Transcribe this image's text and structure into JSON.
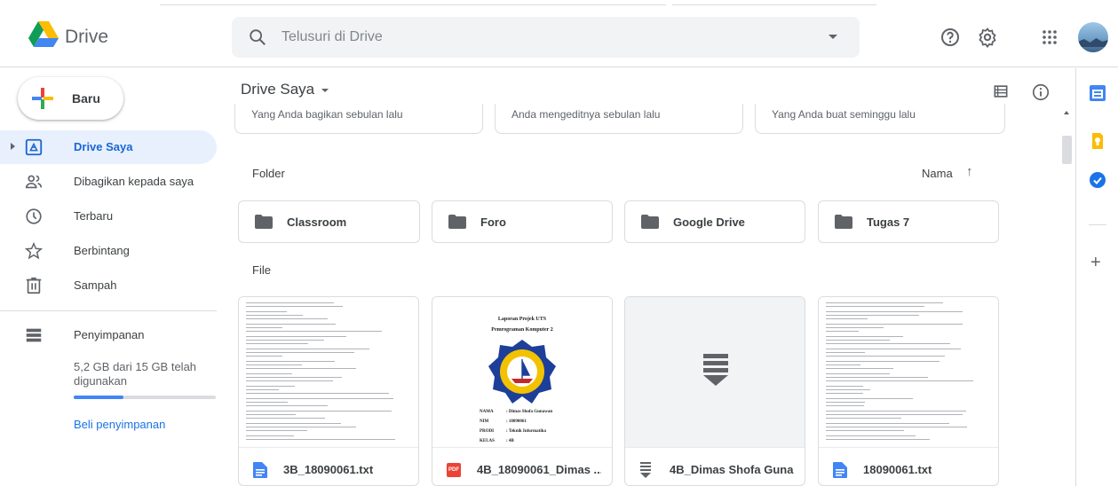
{
  "app": {
    "name": "Drive"
  },
  "search": {
    "placeholder": "Telusuri di Drive"
  },
  "sidebar": {
    "new_button": "Baru",
    "items": [
      {
        "label": "Drive Saya",
        "icon": "drive-icon",
        "active": true
      },
      {
        "label": "Dibagikan kepada saya",
        "icon": "shared-people-icon"
      },
      {
        "label": "Terbaru",
        "icon": "clock-icon"
      },
      {
        "label": "Berbintang",
        "icon": "star-icon"
      },
      {
        "label": "Sampah",
        "icon": "trash-icon"
      }
    ],
    "storage": {
      "label": "Penyimpanan",
      "usage_text": "5,2 GB dari 15 GB telah digunakan",
      "used_fraction": 0.347,
      "buy_label": "Beli penyimpanan"
    }
  },
  "main": {
    "breadcrumb": "Drive Saya",
    "quick_access": [
      "Yang Anda bagikan sebulan lalu",
      "Anda mengeditnya sebulan lalu",
      "Yang Anda buat seminggu lalu"
    ],
    "folder_section": "Folder",
    "sort_label": "Nama",
    "sort_arrow": "↑",
    "folders": [
      "Classroom",
      "Foro",
      "Google Drive",
      "Tugas 7"
    ],
    "file_section": "File",
    "files": [
      {
        "name": "3B_18090061.txt",
        "type": "doc-icon"
      },
      {
        "name": "4B_18090061_Dimas ...",
        "type": "pdf-icon",
        "type_label": "PDF"
      },
      {
        "name": "4B_Dimas Shofa Guna...",
        "type": "archive-icon"
      },
      {
        "name": "18090061.txt",
        "type": "doc-icon"
      }
    ],
    "pdf_preview": {
      "title": "Laporan Projek UTS",
      "subtitle": "Pemrograman Komputer 2",
      "fields": [
        {
          "k": "NAMA",
          "v": ": Dimas Shofa Gunawan"
        },
        {
          "k": "NIM",
          "v": ": 18090061"
        },
        {
          "k": "PRODI",
          "v": ": Teknik Informatika"
        },
        {
          "k": "KELAS",
          "v": ": 4B"
        }
      ]
    }
  },
  "colors": {
    "accent": "#1a73e8",
    "active_bg": "#e8f0fe",
    "doc_blue": "#4285f4",
    "pdf_red": "#ea4335"
  }
}
